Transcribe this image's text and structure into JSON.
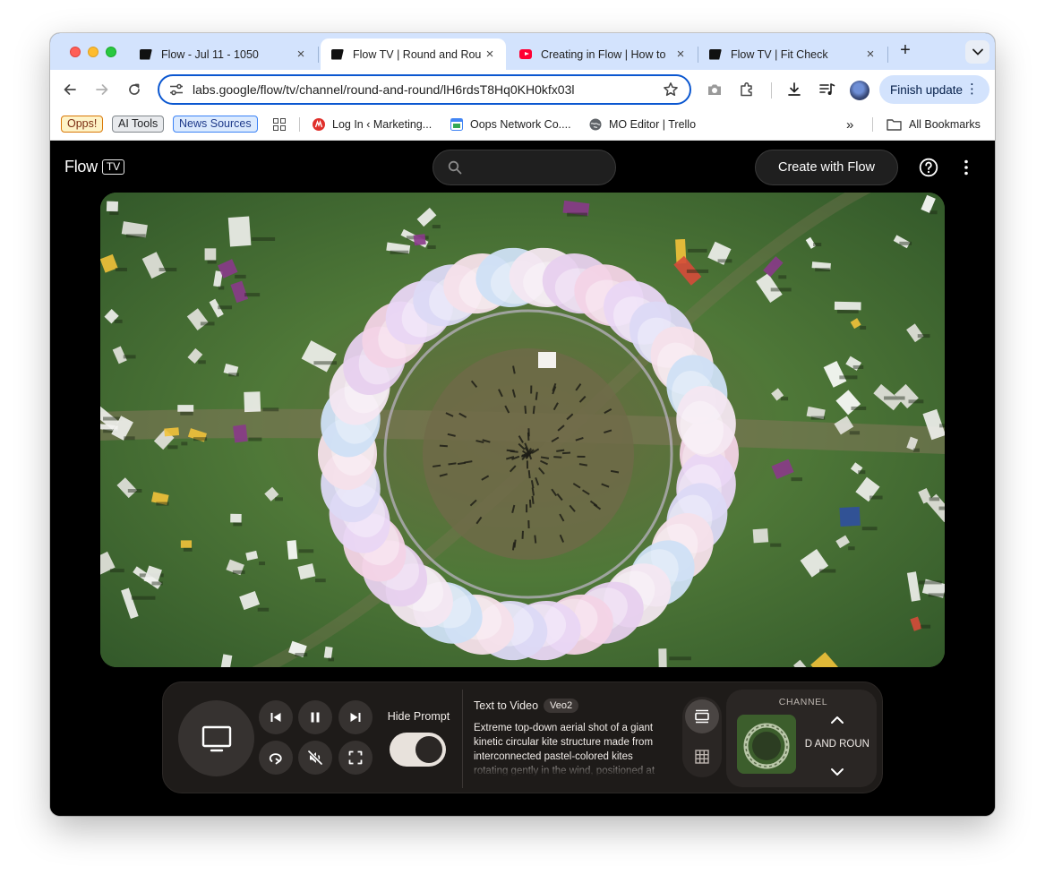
{
  "browser": {
    "tabs": [
      {
        "title": "Flow - Jul 11 - 1050",
        "favicon": "flow-favicon",
        "active": false
      },
      {
        "title": "Flow TV | Round and Rou",
        "favicon": "flow-favicon",
        "active": true
      },
      {
        "title": "Creating in Flow | How to",
        "favicon": "youtube-favicon",
        "active": false
      },
      {
        "title": "Flow TV | Fit Check",
        "favicon": "flow-favicon",
        "active": false
      }
    ],
    "tab_close_glyph": "×",
    "new_tab_glyph": "+",
    "url": "labs.google/flow/tv/channel/round-and-round/lH6rdsT8Hq0KH0kfx03l",
    "finish_update_label": "Finish update",
    "menu_glyph": "⋮",
    "accent_color": "#0b57d0"
  },
  "bookmarks": {
    "chips": [
      "Opps!",
      "AI Tools",
      "News Sources"
    ],
    "items": [
      {
        "label": "Log In ‹ Marketing...",
        "favicon": "marketing-favicon"
      },
      {
        "label": "Oops Network Co....",
        "favicon": "calendar-favicon"
      },
      {
        "label": "MO Editor | Trello",
        "favicon": "globe-favicon"
      }
    ],
    "overflow_glyph": "»",
    "all_bookmarks": "All Bookmarks"
  },
  "app": {
    "logo_word": "Flow",
    "logo_badge": "TV",
    "search_placeholder": "",
    "create_button": "Create with Flow"
  },
  "player": {
    "hide_prompt_label": "Hide Prompt",
    "hide_prompt_on": true,
    "prompt_title": "Text to Video",
    "model_badge": "Veo2",
    "prompt_text": "Extreme top-down aerial shot of a giant kinetic circular kite structure made from interconnected pastel-colored kites rotating gently in the wind, positioned at",
    "channel_label": "CHANNEL",
    "channel_name": "ID AND ROUN"
  }
}
